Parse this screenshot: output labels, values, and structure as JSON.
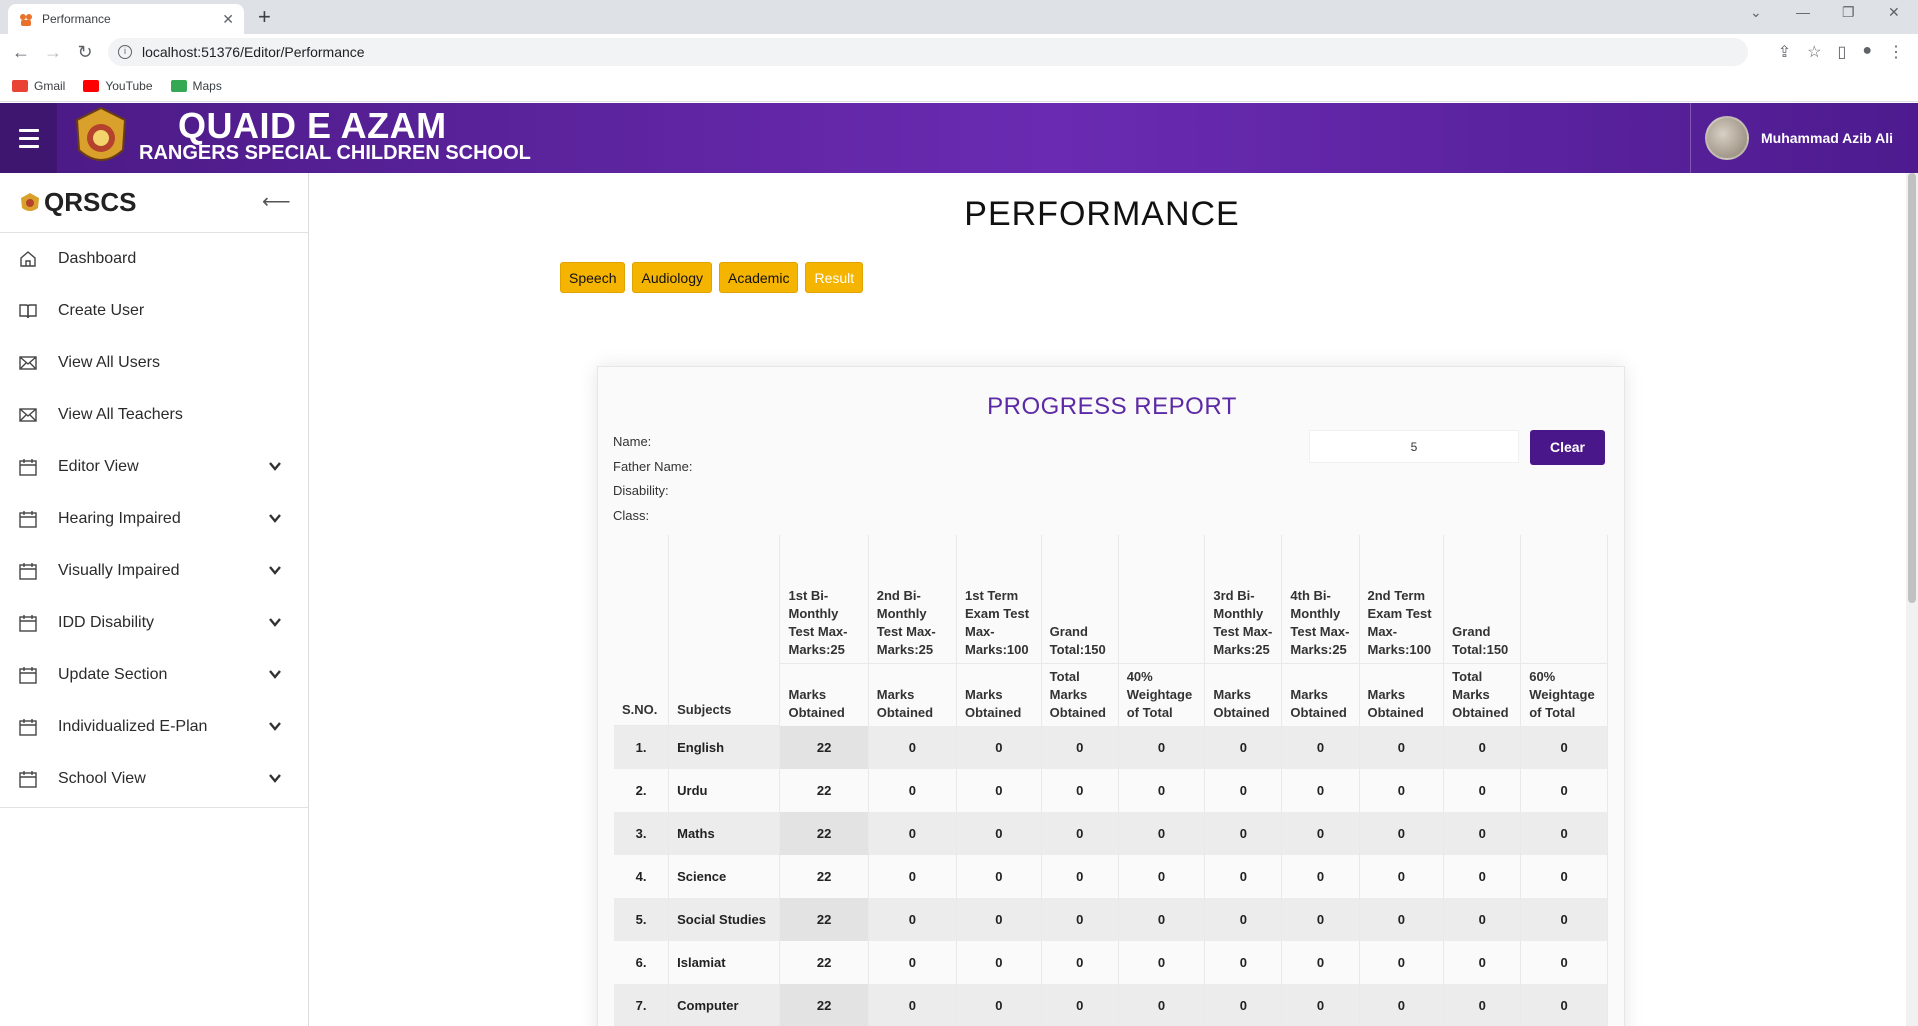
{
  "browser": {
    "tab_title": "Performance",
    "url": "localhost:51376/Editor/Performance",
    "bookmarks": [
      {
        "label": "Gmail",
        "color": "#ea4335"
      },
      {
        "label": "YouTube",
        "color": "#ff0000"
      },
      {
        "label": "Maps",
        "color": "#34a853"
      }
    ]
  },
  "header": {
    "school_title": "QUAID E AZAM",
    "school_subtitle": "RANGERS SPECIAL CHILDREN SCHOOL",
    "user_name": "Muhammad Azib Ali",
    "gradient_start": "#4b1a85",
    "gradient_end": "#6a2bb2"
  },
  "sidebar": {
    "brand": "QRSCS",
    "items": [
      {
        "label": "Dashboard",
        "icon": "home-icon",
        "expandable": false
      },
      {
        "label": "Create User",
        "icon": "book-icon",
        "expandable": false
      },
      {
        "label": "View All Users",
        "icon": "mail-icon",
        "expandable": false
      },
      {
        "label": "View All Teachers",
        "icon": "mail-icon",
        "expandable": false
      },
      {
        "label": "Editor View",
        "icon": "calendar-icon",
        "expandable": true
      },
      {
        "label": "Hearing Impaired",
        "icon": "calendar-icon",
        "expandable": true
      },
      {
        "label": "Visually Impaired",
        "icon": "calendar-icon",
        "expandable": true
      },
      {
        "label": "IDD Disability",
        "icon": "calendar-icon",
        "expandable": true
      },
      {
        "label": "Update Section",
        "icon": "calendar-icon",
        "expandable": true
      },
      {
        "label": "Individualized E-Plan",
        "icon": "calendar-icon",
        "expandable": true
      },
      {
        "label": "School View",
        "icon": "calendar-icon",
        "expandable": true
      }
    ]
  },
  "main": {
    "page_title": "PERFORMANCE",
    "tabs": [
      {
        "label": "Speech",
        "active": false
      },
      {
        "label": "Audiology",
        "active": false
      },
      {
        "label": "Academic",
        "active": false
      },
      {
        "label": "Result",
        "active": true
      }
    ],
    "accent_color": "#f5b400"
  },
  "report": {
    "title": "PROGRESS REPORT",
    "title_color": "#5d2aa5",
    "fields": {
      "name": "Name:",
      "father_name": "Father Name:",
      "disability": "Disability:",
      "class": "Class:"
    },
    "search_value": "5",
    "clear_label": "Clear",
    "header_top": [
      "1st Bi-Monthly Test Max-Marks:25",
      "2nd Bi-Monthly Test Max-Marks:25",
      "1st Term Exam Test Max-Marks:100",
      "Grand Total:150",
      "",
      "3rd Bi-Monthly Test Max-Marks:25",
      "4th Bi-Monthly Test Max-Marks:25",
      "2nd Term Exam Test Max-Marks:100",
      "Grand Total:150",
      ""
    ],
    "header_sno": "S.NO.",
    "header_subjects": "Subjects",
    "header_sub": [
      "Marks Obtained",
      "Marks Obtained",
      "Marks Obtained",
      "Total Marks Obtained",
      "40% Weightage of Total",
      "Marks Obtained",
      "Marks Obtained",
      "Marks Obtained",
      "Total Marks Obtained",
      "60% Weightage of Total"
    ],
    "rows": [
      {
        "sno": "1.",
        "subject": "English",
        "values": [
          "22",
          "0",
          "0",
          "0",
          "0",
          "0",
          "0",
          "0",
          "0",
          "0"
        ]
      },
      {
        "sno": "2.",
        "subject": "Urdu",
        "values": [
          "22",
          "0",
          "0",
          "0",
          "0",
          "0",
          "0",
          "0",
          "0",
          "0"
        ]
      },
      {
        "sno": "3.",
        "subject": "Maths",
        "values": [
          "22",
          "0",
          "0",
          "0",
          "0",
          "0",
          "0",
          "0",
          "0",
          "0"
        ]
      },
      {
        "sno": "4.",
        "subject": "Science",
        "values": [
          "22",
          "0",
          "0",
          "0",
          "0",
          "0",
          "0",
          "0",
          "0",
          "0"
        ]
      },
      {
        "sno": "5.",
        "subject": "Social Studies",
        "values": [
          "22",
          "0",
          "0",
          "0",
          "0",
          "0",
          "0",
          "0",
          "0",
          "0"
        ]
      },
      {
        "sno": "6.",
        "subject": "Islamiat",
        "values": [
          "22",
          "0",
          "0",
          "0",
          "0",
          "0",
          "0",
          "0",
          "0",
          "0"
        ]
      },
      {
        "sno": "7.",
        "subject": "Computer",
        "values": [
          "22",
          "0",
          "0",
          "0",
          "0",
          "0",
          "0",
          "0",
          "0",
          "0"
        ]
      }
    ]
  }
}
